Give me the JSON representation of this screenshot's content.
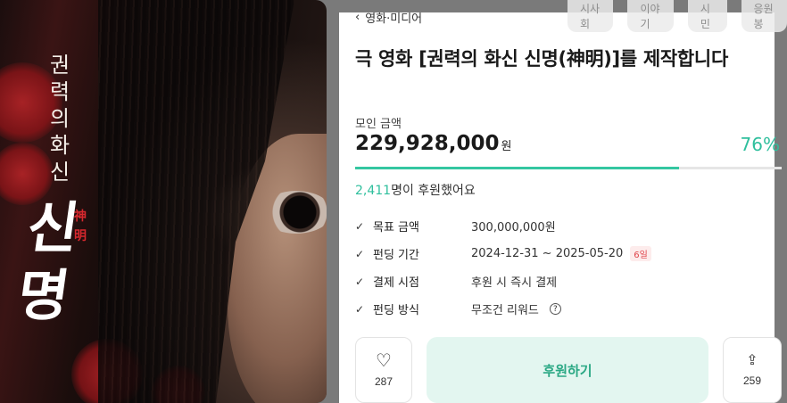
{
  "poster": {
    "vertical_title": [
      "권",
      "력",
      "의",
      "화",
      "신"
    ],
    "big_title": [
      "신",
      "명"
    ],
    "hanja": [
      "神",
      "明"
    ]
  },
  "topnav": [
    "시사회",
    "이야기",
    "시민",
    "응원봉"
  ],
  "breadcrumb": {
    "label": "영화·미디어"
  },
  "project": {
    "title": "극 영화 [권력의 화신 신명(神明)]를 제작합니다",
    "raised_label": "모인 금액",
    "raised_amount": "229,928,000",
    "raised_unit": "원",
    "percent": "76%",
    "progress_fraction": 0.76,
    "backers_count": "2,411",
    "backers_suffix": "명이 후원했어요"
  },
  "info": [
    {
      "label": "목표 금액",
      "value": "300,000,000원"
    },
    {
      "label": "펀딩 기간",
      "value": "2024-12-31 ~ 2025-05-20",
      "badge": "6일"
    },
    {
      "label": "결제 시점",
      "value": "후원 시 즉시 결제"
    },
    {
      "label": "펀딩 방식",
      "value": "무조건 리워드"
    }
  ],
  "actions": {
    "like_count": "287",
    "support_label": "후원하기",
    "share_count": "259"
  },
  "colors": {
    "accent": "#2fbf9d",
    "support_bg": "#e3f6f0",
    "badge_red": "#e0454b"
  }
}
